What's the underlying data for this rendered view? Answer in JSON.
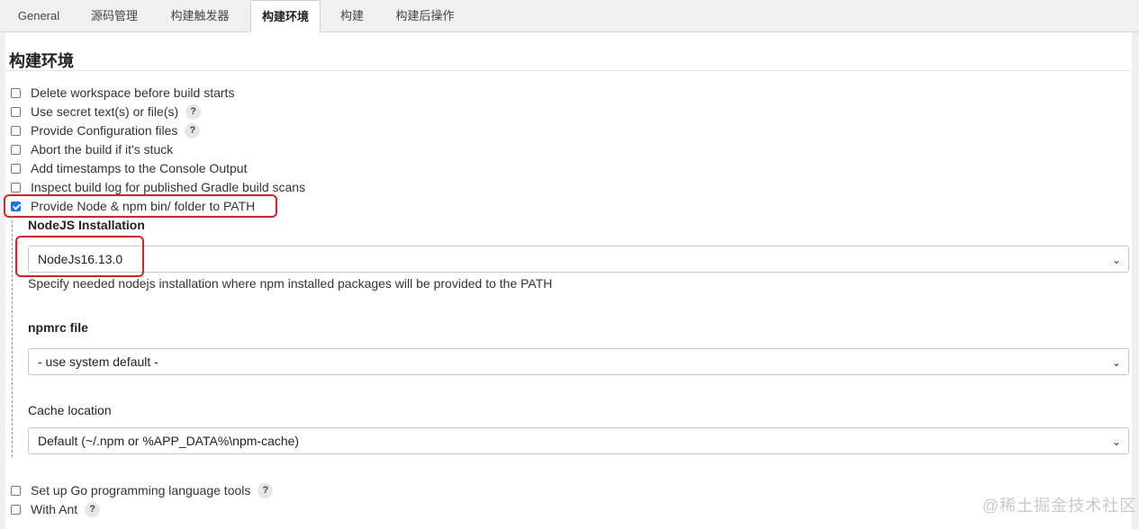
{
  "tabs": [
    {
      "label": "General"
    },
    {
      "label": "源码管理"
    },
    {
      "label": "构建触发器"
    },
    {
      "label": "构建环境"
    },
    {
      "label": "构建"
    },
    {
      "label": "构建后操作"
    }
  ],
  "active_tab": "构建环境",
  "section": {
    "title": "构建环境"
  },
  "options": [
    {
      "label": "Delete workspace before build starts",
      "checked": false,
      "help": false
    },
    {
      "label": "Use secret text(s) or file(s)",
      "checked": false,
      "help": true
    },
    {
      "label": "Provide Configuration files",
      "checked": false,
      "help": true
    },
    {
      "label": "Abort the build if it's stuck",
      "checked": false,
      "help": false
    },
    {
      "label": "Add timestamps to the Console Output",
      "checked": false,
      "help": false
    },
    {
      "label": "Inspect build log for published Gradle build scans",
      "checked": false,
      "help": false
    },
    {
      "label": "Provide Node & npm bin/ folder to PATH",
      "checked": true,
      "help": false
    }
  ],
  "help_glyph": "?",
  "nodejs": {
    "installation_label": "NodeJS Installation",
    "installation_value": "NodeJs16.13.0",
    "installation_desc": "Specify needed nodejs installation where npm installed packages will be provided to the PATH",
    "npmrc_label": "npmrc file",
    "npmrc_value": "- use system default -",
    "cache_label": "Cache location",
    "cache_value": "Default (~/.npm or %APP_DATA%\\npm-cache)"
  },
  "bottom_options": [
    {
      "label": "Set up Go programming language tools",
      "checked": false,
      "help": true
    },
    {
      "label": "With Ant",
      "checked": false,
      "help": true
    }
  ],
  "select_chevron": "⌄",
  "watermark": "@稀土掘金技术社区",
  "colors": {
    "highlight": "#e02020",
    "checkbox_checked": "#1a73e8",
    "tab_bar": "#f0f0f0"
  }
}
